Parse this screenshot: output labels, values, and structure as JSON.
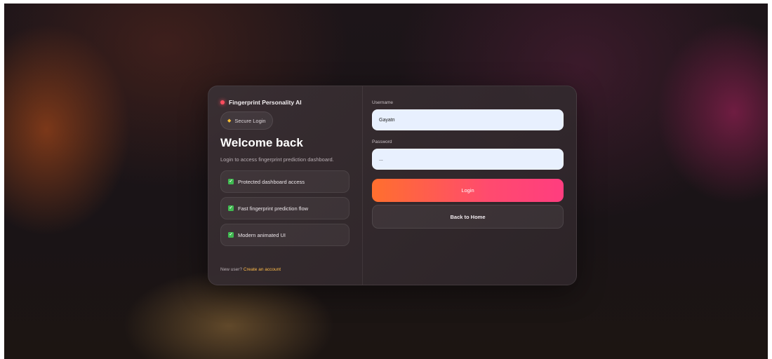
{
  "brand": {
    "name": "Fingerprint Personality AI",
    "dot_color": "#ff4d5e"
  },
  "badge": {
    "icon": "star-icon",
    "label": "Secure Login"
  },
  "welcome": {
    "title": "Welcome back",
    "subtitle": "Login to access fingerprint prediction dashboard."
  },
  "features": [
    {
      "icon": "checkbox-checked-icon",
      "label": "Protected dashboard access"
    },
    {
      "icon": "checkbox-checked-icon",
      "label": "Fast fingerprint prediction flow"
    },
    {
      "icon": "checkbox-checked-icon",
      "label": "Modern animated UI"
    }
  ],
  "signup": {
    "prompt": "New user?",
    "link": "Create an account"
  },
  "form": {
    "username_label": "Username",
    "username_value": "Gayatri",
    "password_label": "Password",
    "password_value": "...",
    "login_button": "Login",
    "home_button": "Back to Home"
  },
  "colors": {
    "accent_gradient_start": "#ff6f2e",
    "accent_gradient_end": "#ff3d7f",
    "link": "#ffbd4a",
    "check": "#3fb950"
  }
}
